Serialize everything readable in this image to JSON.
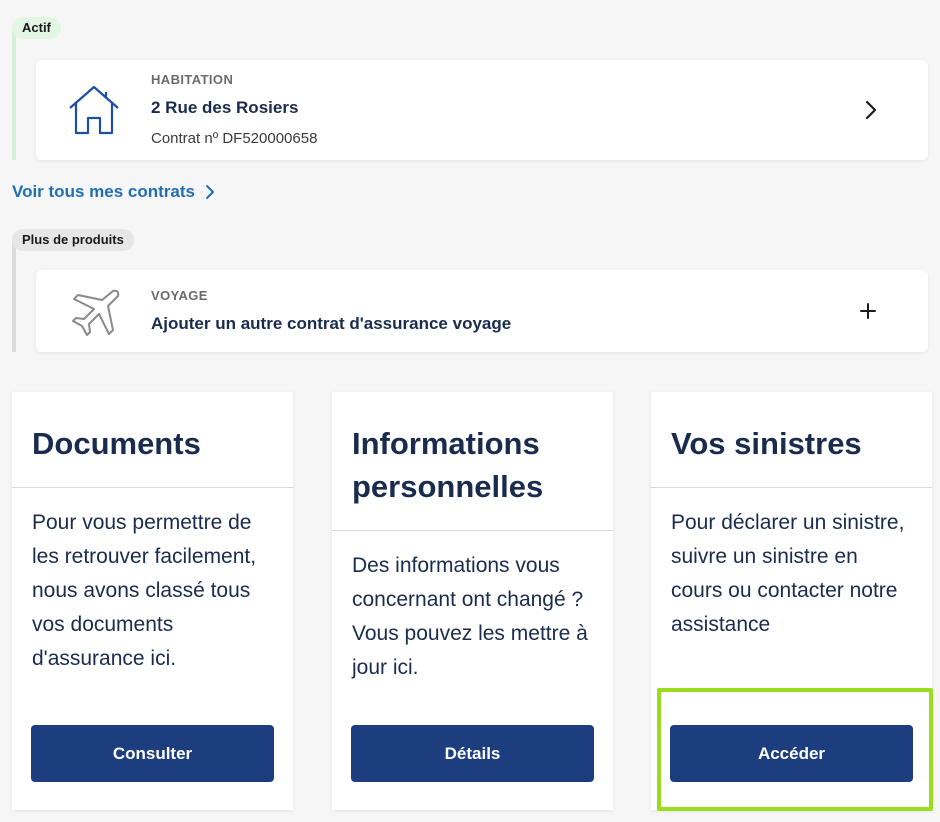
{
  "active_section": {
    "badge": "Actif",
    "badge_color": "#e3f5e3",
    "bar_color": "#d6f0d6",
    "contract": {
      "icon": "house-icon",
      "type": "HABITATION",
      "title": "2 Rue des Rosiers",
      "subtitle": "Contrat nº DF520000658",
      "action_icon": "chevron-right-icon"
    },
    "see_all": {
      "label": "Voir tous mes contrats",
      "icon": "chevron-right-icon"
    }
  },
  "more_products_section": {
    "badge": "Plus de produits",
    "badge_color": "#e6e6e6",
    "bar_color": "#dcdcdc",
    "product": {
      "icon": "airplane-icon",
      "type": "VOYAGE",
      "title": "Ajouter un autre contrat d'assurance voyage",
      "action_icon": "plus-icon"
    }
  },
  "tiles": [
    {
      "title": "Documents",
      "body": "Pour vous permettre de les retrouver facilement, nous avons classé tous vos documents d'assurance ici.",
      "button": "Consulter"
    },
    {
      "title": "Informations personnelles",
      "body": "Des informations vous concernant ont changé ? Vous pouvez les mettre à jour ici.",
      "button": "Détails"
    },
    {
      "title": "Vos sinistres",
      "body": "Pour déclarer un sinistre, suivre un sinistre en cours ou contacter notre assistance",
      "button": "Accéder"
    }
  ],
  "colors": {
    "primary_navy": "#1a2c4e",
    "button_blue": "#1c3e7e",
    "link_blue": "#1f6fb5",
    "highlight_green": "#9bdc1e"
  }
}
